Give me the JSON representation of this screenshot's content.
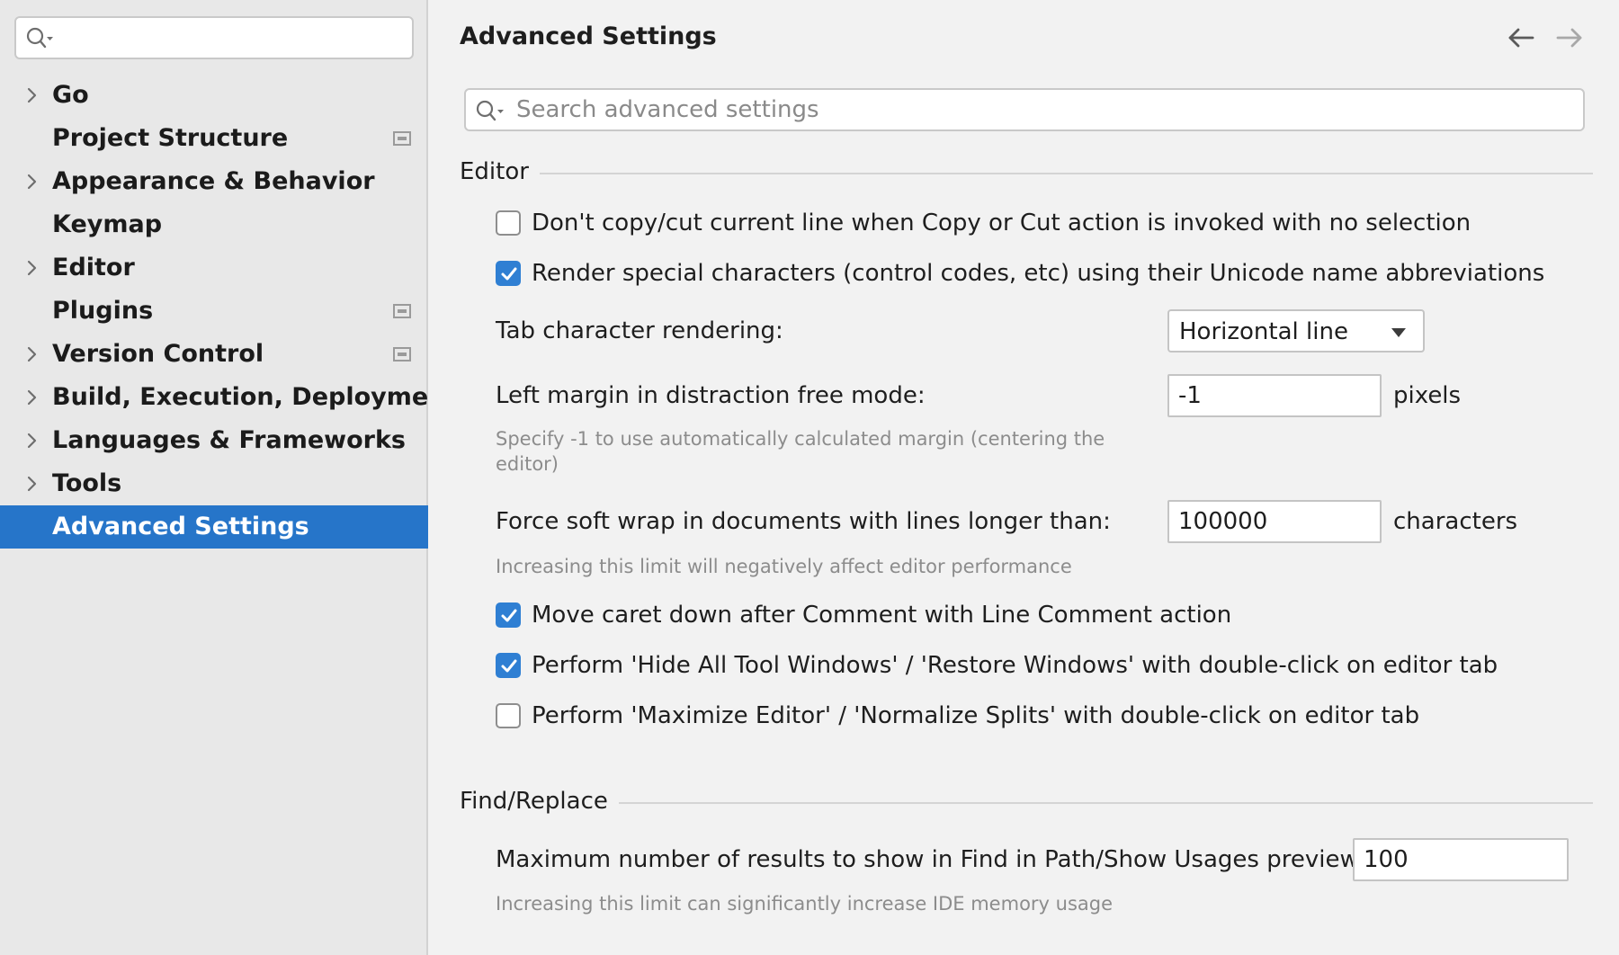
{
  "sidebar": {
    "search": {
      "value": "",
      "placeholder": ""
    },
    "items": [
      {
        "label": "Go",
        "expandable": true,
        "project_icon": false,
        "selected": false
      },
      {
        "label": "Project Structure",
        "expandable": false,
        "project_icon": true,
        "selected": false
      },
      {
        "label": "Appearance & Behavior",
        "expandable": true,
        "project_icon": false,
        "selected": false
      },
      {
        "label": "Keymap",
        "expandable": false,
        "project_icon": false,
        "selected": false
      },
      {
        "label": "Editor",
        "expandable": true,
        "project_icon": false,
        "selected": false
      },
      {
        "label": "Plugins",
        "expandable": false,
        "project_icon": true,
        "selected": false
      },
      {
        "label": "Version Control",
        "expandable": true,
        "project_icon": true,
        "selected": false
      },
      {
        "label": "Build, Execution, Deployment",
        "expandable": true,
        "project_icon": false,
        "selected": false
      },
      {
        "label": "Languages & Frameworks",
        "expandable": true,
        "project_icon": false,
        "selected": false
      },
      {
        "label": "Tools",
        "expandable": true,
        "project_icon": false,
        "selected": false
      },
      {
        "label": "Advanced Settings",
        "expandable": false,
        "project_icon": false,
        "selected": true
      }
    ]
  },
  "header": {
    "title": "Advanced Settings",
    "back_icon": "arrow-left-icon",
    "forward_icon": "arrow-right-icon"
  },
  "search": {
    "placeholder": "Search advanced settings",
    "value": ""
  },
  "editor": {
    "title": "Editor",
    "copy_cut": {
      "label": "Don't copy/cut current line when Copy or Cut action is invoked with no selection",
      "checked": false
    },
    "render_special": {
      "label": "Render special characters (control codes, etc) using their Unicode name abbreviations",
      "checked": true
    },
    "tab_rendering": {
      "label": "Tab character rendering:",
      "value": "Horizontal line"
    },
    "left_margin": {
      "label": "Left margin in distraction free mode:",
      "value": "-1",
      "unit": "pixels",
      "hint_line1": "Specify -1 to use automatically calculated margin (centering the",
      "hint_line2": "editor)"
    },
    "soft_wrap": {
      "label": "Force soft wrap in documents with lines longer than:",
      "value": "100000",
      "unit": "characters",
      "hint": "Increasing this limit will negatively affect editor performance"
    },
    "move_caret": {
      "label": "Move caret down after Comment with Line Comment action",
      "checked": true
    },
    "hide_tool_windows": {
      "label": "Perform 'Hide All Tool Windows' / 'Restore Windows' with double-click on editor tab",
      "checked": true
    },
    "maximize_editor": {
      "label": "Perform 'Maximize Editor' / 'Normalize Splits' with double-click on editor tab",
      "checked": false
    }
  },
  "find_replace": {
    "title": "Find/Replace",
    "max_results": {
      "label": "Maximum number of results to show in Find in Path/Show Usages preview:",
      "value": "100",
      "hint": "Increasing this limit can significantly increase IDE memory usage"
    }
  },
  "colors": {
    "accent": "#2675c9",
    "checkbox_checked": "#2f7fd3",
    "sidebar_bg": "#e8e8e8",
    "main_bg": "#f2f2f2",
    "hint_text": "#8c8c8c"
  }
}
